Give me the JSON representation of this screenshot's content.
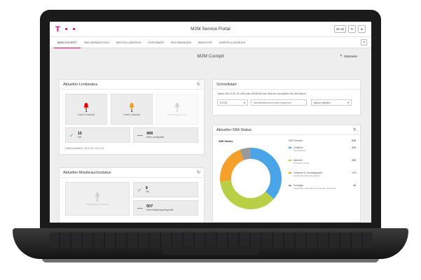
{
  "header": {
    "logo": "T • •",
    "title": "M2M Service Portal",
    "date_chip": "29 10"
  },
  "nav": {
    "items": [
      "M2M COCKPIT",
      "SIM-VERWALTUNG",
      "BESTELLUNGEN ▾",
      "VORGÄNGE",
      "RECHNUNGEN",
      "BERICHTE",
      "EINSTELLUNGEN ▾"
    ],
    "help": "?"
  },
  "cockpit": {
    "title": "M2M Cockpit",
    "home_link": "Startseite"
  },
  "limit_status": {
    "title": "Aktueller Limitstatus",
    "tiles": [
      {
        "count": "1",
        "label": "Limit 2 erreicht",
        "color": "#e20000"
      },
      {
        "count": "1",
        "label": "Limit 1 erreicht",
        "color": "#f29a1e"
      },
      {
        "count": "0",
        "label": "Limit ausgewertet",
        "color": "#d5d5d5"
      }
    ],
    "stats": [
      {
        "num": "15",
        "label": "OK"
      },
      {
        "num": "499",
        "label": "Kein Limitprofil"
      }
    ],
    "timestamp": "Zuletzt aktualisiert: 16.10.18 / 13:17:19"
  },
  "abuse_status": {
    "title": "Aktueller Missbrauchsstatus",
    "tile": {
      "count": "0",
      "label": "Missbrauch erkannt"
    },
    "stats": [
      {
        "num": "9",
        "label": "OK"
      },
      {
        "num": "507",
        "label": "Kein Missbrauchsprofil"
      }
    ]
  },
  "quickstart": {
    "title": "Schnellstart",
    "hint": "Geben Sie CCID, ID, MSI oder MSISDN einer SIM ein und wählen Sie eine Aktion",
    "select_value": "ICCID",
    "input_placeholder": "Identifikationsnummer eingeben",
    "action_value": "Aktion wählen"
  },
  "sim_status": {
    "title": "Aktueller SIM-Status",
    "chart_title": "SIM Status",
    "total_label": "SIM Gesamt",
    "total": "836",
    "legend": [
      {
        "label": "Geliefert",
        "sub": "(Ge.aktiviert)",
        "count": "306",
        "color": "#4aa5e8"
      },
      {
        "label": "Aktiviert",
        "sub": "(Produktiv Kund)",
        "count": "308",
        "color": "#b9cf45"
      },
      {
        "label": "Gesperrt & Sendegeparkt",
        "sub": "(Gesendet & Sendegesperrt)",
        "count": "174",
        "color": "#f5a02a"
      },
      {
        "label": "Sonstige",
        "sub": "(Gesendet, Gesendet & Gesendet, Gesendet)",
        "count": "48",
        "color": "#999999"
      }
    ]
  },
  "chart_data": {
    "type": "pie",
    "title": "SIM Status",
    "categories": [
      "Geliefert",
      "Aktiviert",
      "Gesperrt & Sendegeparkt",
      "Sonstige"
    ],
    "values": [
      306,
      308,
      174,
      48
    ],
    "colors": [
      "#4aa5e8",
      "#b9cf45",
      "#f5a02a",
      "#999999"
    ]
  }
}
